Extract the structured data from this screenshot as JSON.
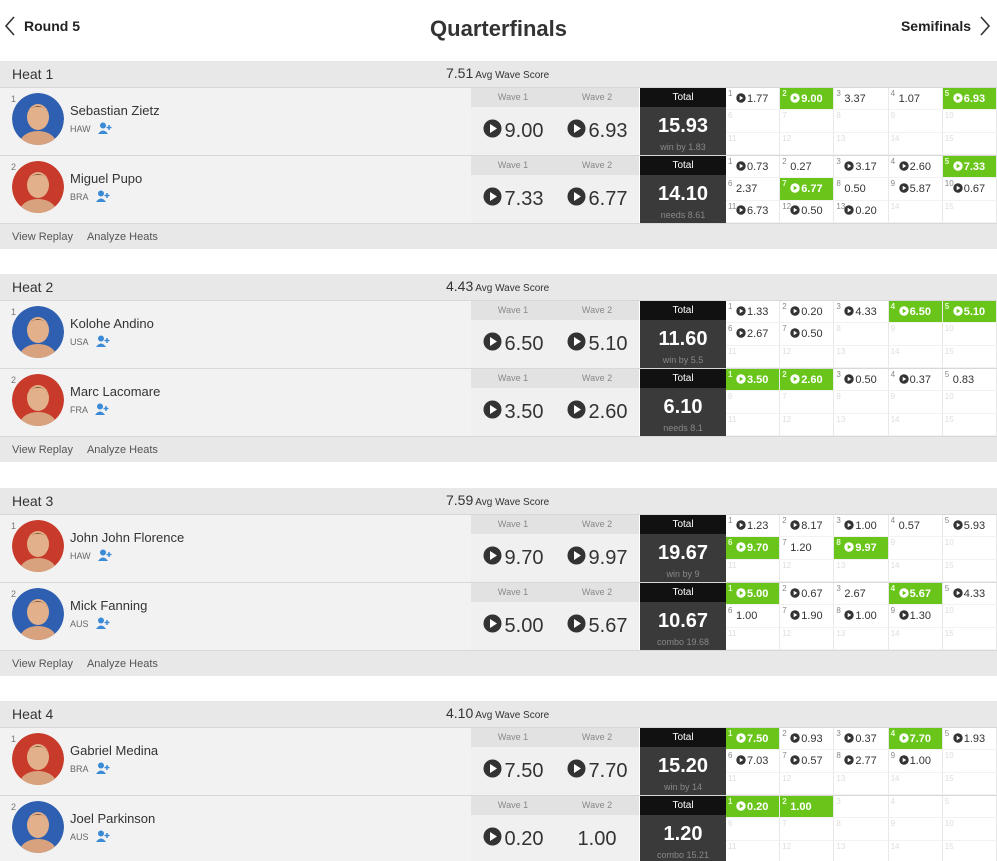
{
  "header": {
    "prev_label": "Round 5",
    "title": "Quarterfinals",
    "next_label": "Semifinals"
  },
  "labels": {
    "avg": "Avg Wave Score",
    "wave1": "Wave 1",
    "wave2": "Wave 2",
    "total": "Total",
    "view_replay": "View Replay",
    "analyze_heats": "Analyze Heats"
  },
  "colors": {
    "highlight": "#6ac51a",
    "total_bg": "#3a3a3a",
    "follow": "#3a8ad6"
  },
  "heats": [
    {
      "name": "Heat 1",
      "avg": "7.51",
      "surfers": [
        {
          "seed": "1",
          "name": "Sebastian Zietz",
          "country": "HAW",
          "avatar_color": "#2e5fb0",
          "wave1": "9.00",
          "wave2": "6.93",
          "total": "15.93",
          "sub": "win by 1.83",
          "waves": [
            [
              "1",
              "1.77",
              true,
              false
            ],
            [
              "2",
              "9.00",
              true,
              true
            ],
            [
              "3",
              "3.37",
              false,
              false
            ],
            [
              "4",
              "1.07",
              false,
              false
            ],
            [
              "5",
              "6.93",
              true,
              true
            ],
            [
              "6",
              "",
              false,
              false
            ],
            [
              "7",
              "",
              false,
              false
            ],
            [
              "8",
              "",
              false,
              false
            ],
            [
              "9",
              "",
              false,
              false
            ],
            [
              "10",
              "",
              false,
              false
            ],
            [
              "11",
              "",
              false,
              false
            ],
            [
              "12",
              "",
              false,
              false
            ],
            [
              "13",
              "",
              false,
              false
            ],
            [
              "14",
              "",
              false,
              false
            ],
            [
              "15",
              "",
              false,
              false
            ]
          ]
        },
        {
          "seed": "2",
          "name": "Miguel Pupo",
          "country": "BRA",
          "avatar_color": "#c83a2a",
          "wave1": "7.33",
          "wave2": "6.77",
          "total": "14.10",
          "sub": "needs 8.61",
          "waves": [
            [
              "1",
              "0.73",
              true,
              false
            ],
            [
              "2",
              "0.27",
              false,
              false
            ],
            [
              "3",
              "3.17",
              true,
              false
            ],
            [
              "4",
              "2.60",
              true,
              false
            ],
            [
              "5",
              "7.33",
              true,
              true
            ],
            [
              "6",
              "2.37",
              false,
              false
            ],
            [
              "7",
              "6.77",
              true,
              true
            ],
            [
              "8",
              "0.50",
              false,
              false
            ],
            [
              "9",
              "5.87",
              true,
              false
            ],
            [
              "10",
              "0.67",
              true,
              false
            ],
            [
              "11",
              "6.73",
              true,
              false
            ],
            [
              "12",
              "0.50",
              true,
              false
            ],
            [
              "13",
              "0.20",
              true,
              false
            ],
            [
              "14",
              "",
              false,
              false
            ],
            [
              "15",
              "",
              false,
              false
            ]
          ]
        }
      ]
    },
    {
      "name": "Heat 2",
      "avg": "4.43",
      "surfers": [
        {
          "seed": "1",
          "name": "Kolohe Andino",
          "country": "USA",
          "avatar_color": "#2e5fb0",
          "wave1": "6.50",
          "wave2": "5.10",
          "total": "11.60",
          "sub": "win by 5.5",
          "waves": [
            [
              "1",
              "1.33",
              true,
              false
            ],
            [
              "2",
              "0.20",
              true,
              false
            ],
            [
              "3",
              "4.33",
              true,
              false
            ],
            [
              "4",
              "6.50",
              true,
              true
            ],
            [
              "5",
              "5.10",
              true,
              true
            ],
            [
              "6",
              "2.67",
              true,
              false
            ],
            [
              "7",
              "0.50",
              true,
              false
            ],
            [
              "8",
              "",
              false,
              false
            ],
            [
              "9",
              "",
              false,
              false
            ],
            [
              "10",
              "",
              false,
              false
            ],
            [
              "11",
              "",
              false,
              false
            ],
            [
              "12",
              "",
              false,
              false
            ],
            [
              "13",
              "",
              false,
              false
            ],
            [
              "14",
              "",
              false,
              false
            ],
            [
              "15",
              "",
              false,
              false
            ]
          ]
        },
        {
          "seed": "2",
          "name": "Marc Lacomare",
          "country": "FRA",
          "avatar_color": "#c83a2a",
          "wave1": "3.50",
          "wave2": "2.60",
          "total": "6.10",
          "sub": "needs 8.1",
          "waves": [
            [
              "1",
              "3.50",
              true,
              true
            ],
            [
              "2",
              "2.60",
              true,
              true
            ],
            [
              "3",
              "0.50",
              true,
              false
            ],
            [
              "4",
              "0.37",
              true,
              false
            ],
            [
              "5",
              "0.83",
              false,
              false
            ],
            [
              "6",
              "",
              false,
              false
            ],
            [
              "7",
              "",
              false,
              false
            ],
            [
              "8",
              "",
              false,
              false
            ],
            [
              "9",
              "",
              false,
              false
            ],
            [
              "10",
              "",
              false,
              false
            ],
            [
              "11",
              "",
              false,
              false
            ],
            [
              "12",
              "",
              false,
              false
            ],
            [
              "13",
              "",
              false,
              false
            ],
            [
              "14",
              "",
              false,
              false
            ],
            [
              "15",
              "",
              false,
              false
            ]
          ]
        }
      ]
    },
    {
      "name": "Heat 3",
      "avg": "7.59",
      "surfers": [
        {
          "seed": "1",
          "name": "John John Florence",
          "country": "HAW",
          "avatar_color": "#c83a2a",
          "wave1": "9.70",
          "wave2": "9.97",
          "total": "19.67",
          "sub": "win by 9",
          "waves": [
            [
              "1",
              "1.23",
              true,
              false
            ],
            [
              "2",
              "8.17",
              true,
              false
            ],
            [
              "3",
              "1.00",
              true,
              false
            ],
            [
              "4",
              "0.57",
              false,
              false
            ],
            [
              "5",
              "5.93",
              true,
              false
            ],
            [
              "6",
              "9.70",
              true,
              true
            ],
            [
              "7",
              "1.20",
              false,
              false
            ],
            [
              "8",
              "9.97",
              true,
              true
            ],
            [
              "9",
              "",
              false,
              false
            ],
            [
              "10",
              "",
              false,
              false
            ],
            [
              "11",
              "",
              false,
              false
            ],
            [
              "12",
              "",
              false,
              false
            ],
            [
              "13",
              "",
              false,
              false
            ],
            [
              "14",
              "",
              false,
              false
            ],
            [
              "15",
              "",
              false,
              false
            ]
          ]
        },
        {
          "seed": "2",
          "name": "Mick Fanning",
          "country": "AUS",
          "avatar_color": "#2e5fb0",
          "wave1": "5.00",
          "wave2": "5.67",
          "total": "10.67",
          "sub": "combo 19.68",
          "waves": [
            [
              "1",
              "5.00",
              true,
              true
            ],
            [
              "2",
              "0.67",
              true,
              false
            ],
            [
              "3",
              "2.67",
              false,
              false
            ],
            [
              "4",
              "5.67",
              true,
              true
            ],
            [
              "5",
              "4.33",
              true,
              false
            ],
            [
              "6",
              "1.00",
              false,
              false
            ],
            [
              "7",
              "1.90",
              true,
              false
            ],
            [
              "8",
              "1.00",
              true,
              false
            ],
            [
              "9",
              "1.30",
              true,
              false
            ],
            [
              "10",
              "",
              false,
              false
            ],
            [
              "11",
              "",
              false,
              false
            ],
            [
              "12",
              "",
              false,
              false
            ],
            [
              "13",
              "",
              false,
              false
            ],
            [
              "14",
              "",
              false,
              false
            ],
            [
              "15",
              "",
              false,
              false
            ]
          ]
        }
      ]
    },
    {
      "name": "Heat 4",
      "avg": "4.10",
      "surfers": [
        {
          "seed": "1",
          "name": "Gabriel Medina",
          "country": "BRA",
          "avatar_color": "#c83a2a",
          "wave1": "7.50",
          "wave2": "7.70",
          "total": "15.20",
          "sub": "win by 14",
          "waves": [
            [
              "1",
              "7.50",
              true,
              true
            ],
            [
              "2",
              "0.93",
              true,
              false
            ],
            [
              "3",
              "0.37",
              true,
              false
            ],
            [
              "4",
              "7.70",
              true,
              true
            ],
            [
              "5",
              "1.93",
              true,
              false
            ],
            [
              "6",
              "7.03",
              true,
              false
            ],
            [
              "7",
              "0.57",
              true,
              false
            ],
            [
              "8",
              "2.77",
              true,
              false
            ],
            [
              "9",
              "1.00",
              true,
              false
            ],
            [
              "10",
              "",
              false,
              false
            ],
            [
              "11",
              "",
              false,
              false
            ],
            [
              "12",
              "",
              false,
              false
            ],
            [
              "13",
              "",
              false,
              false
            ],
            [
              "14",
              "",
              false,
              false
            ],
            [
              "15",
              "",
              false,
              false
            ]
          ]
        },
        {
          "seed": "2",
          "name": "Joel Parkinson",
          "country": "AUS",
          "avatar_color": "#2e5fb0",
          "wave1": "0.20",
          "wave2": "1.00",
          "wave2_play": false,
          "total": "1.20",
          "sub": "combo 15.21",
          "waves": [
            [
              "1",
              "0.20",
              true,
              true
            ],
            [
              "2",
              "1.00",
              false,
              true
            ],
            [
              "3",
              "",
              false,
              false
            ],
            [
              "4",
              "",
              false,
              false
            ],
            [
              "5",
              "",
              false,
              false
            ],
            [
              "6",
              "",
              false,
              false
            ],
            [
              "7",
              "",
              false,
              false
            ],
            [
              "8",
              "",
              false,
              false
            ],
            [
              "9",
              "",
              false,
              false
            ],
            [
              "10",
              "",
              false,
              false
            ],
            [
              "11",
              "",
              false,
              false
            ],
            [
              "12",
              "",
              false,
              false
            ],
            [
              "13",
              "",
              false,
              false
            ],
            [
              "14",
              "",
              false,
              false
            ],
            [
              "15",
              "",
              false,
              false
            ]
          ]
        }
      ]
    }
  ]
}
